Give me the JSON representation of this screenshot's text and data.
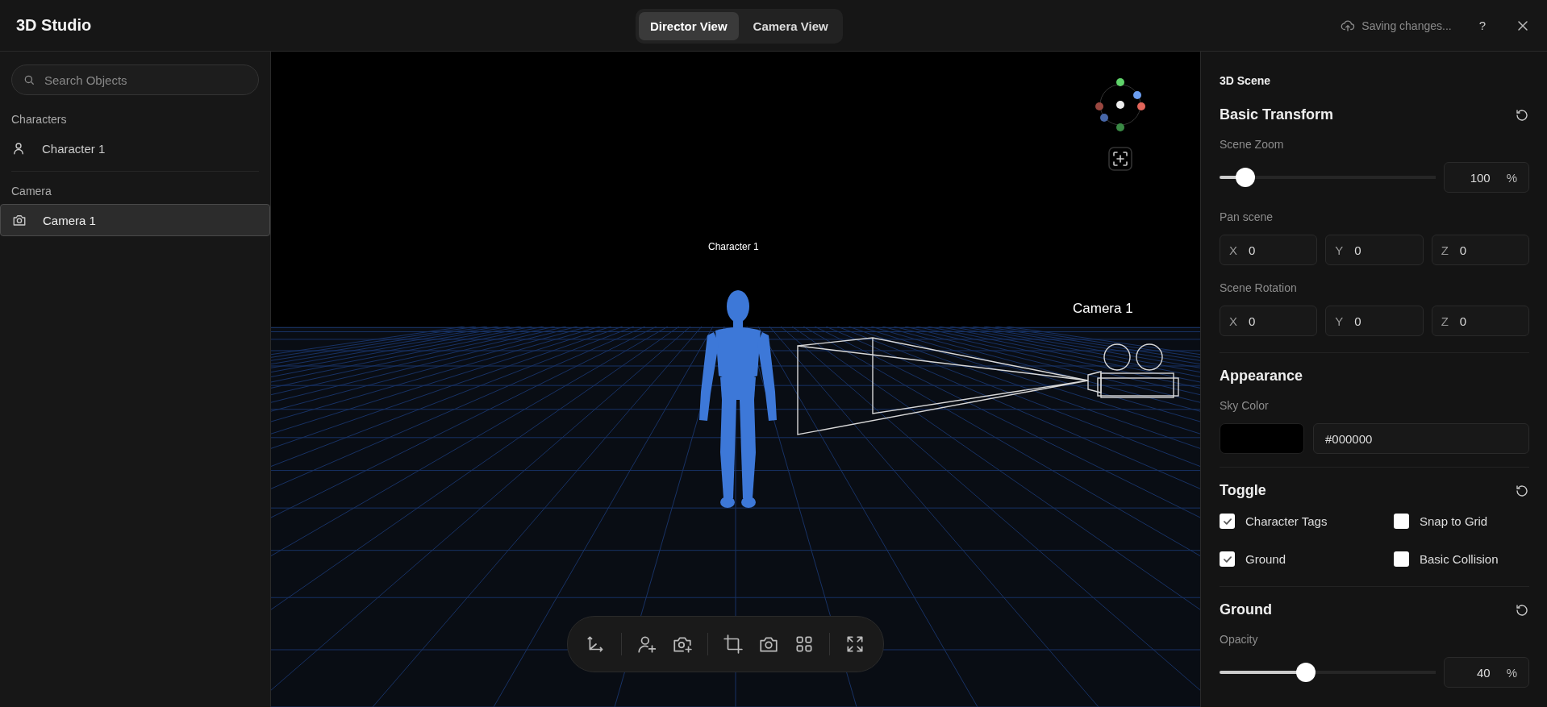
{
  "app": {
    "title": "3D Studio"
  },
  "view_tabs": [
    {
      "label": "Director View",
      "selected": true
    },
    {
      "label": "Camera View",
      "selected": false
    }
  ],
  "header": {
    "status": "Saving changes...",
    "help": "?"
  },
  "sidebar": {
    "search": {
      "placeholder": "Search Objects"
    },
    "groups": [
      {
        "title": "Characters",
        "items": [
          {
            "label": "Character 1",
            "kind": "character",
            "selected": false
          }
        ]
      },
      {
        "title": "Camera",
        "items": [
          {
            "label": "Camera 1",
            "kind": "camera",
            "selected": true
          }
        ]
      }
    ]
  },
  "viewport": {
    "tags": [
      {
        "label": "Character 1",
        "kind": "character"
      },
      {
        "label": "Camera 1",
        "kind": "camera"
      }
    ]
  },
  "panel": {
    "title": "3D Scene",
    "transform": {
      "title": "Basic Transform",
      "zoom": {
        "label": "Scene Zoom",
        "level": 0.12,
        "value": "100",
        "unit": "%"
      },
      "pan": {
        "label": "Pan scene",
        "fields": [
          {
            "axis": "X",
            "value": "0"
          },
          {
            "axis": "Y",
            "value": "0"
          },
          {
            "axis": "Z",
            "value": "0"
          }
        ]
      },
      "rotation": {
        "label": "Scene Rotation",
        "fields": [
          {
            "axis": "X",
            "value": "0"
          },
          {
            "axis": "Y",
            "value": "0"
          },
          {
            "axis": "Z",
            "value": "0"
          }
        ]
      }
    },
    "appearance": {
      "title": "Appearance",
      "sky": {
        "label": "Sky Color",
        "value": "#000000"
      }
    },
    "toggles": {
      "title": "Toggle",
      "items": [
        {
          "label": "Character Tags",
          "checked": true
        },
        {
          "label": "Snap to Grid",
          "checked": false
        },
        {
          "label": "Ground",
          "checked": true
        },
        {
          "label": "Basic Collision",
          "checked": false
        }
      ]
    },
    "ground": {
      "title": "Ground",
      "opacity": {
        "label": "Opacity",
        "level": 0.4,
        "value": "40",
        "unit": "%"
      }
    }
  }
}
